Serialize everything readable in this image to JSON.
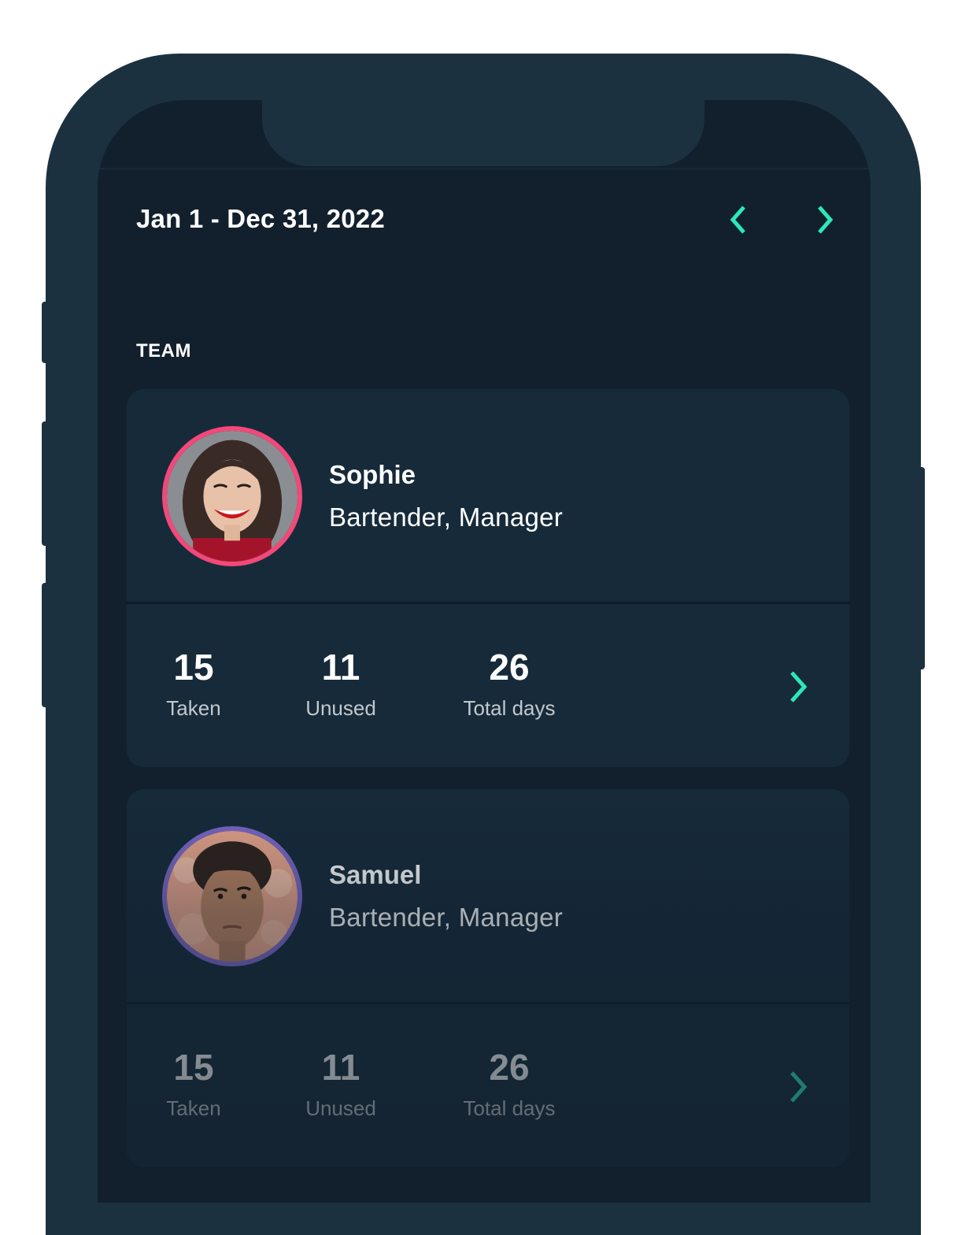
{
  "header": {
    "date_range": "Jan 1 - Dec 31, 2022",
    "prev_icon": "chevron-left-icon",
    "next_icon": "chevron-right-icon"
  },
  "section_title": "TEAM",
  "colors": {
    "accent": "#2de8b8",
    "screen_bg": "#12202d",
    "card_bg": "#162a3a",
    "frame": "#1c3140"
  },
  "team": [
    {
      "name": "Sophie",
      "role": "Bartender, Manager",
      "ring_color": "#f2487a",
      "stats": [
        {
          "value": "15",
          "label": "Taken"
        },
        {
          "value": "11",
          "label": "Unused"
        },
        {
          "value": "26",
          "label": "Total days"
        }
      ],
      "open_icon": "chevron-right-icon"
    },
    {
      "name": "Samuel",
      "role": "Bartender, Manager",
      "ring_color": "#7b68c9",
      "stats": [
        {
          "value": "15",
          "label": "Taken"
        },
        {
          "value": "11",
          "label": "Unused"
        },
        {
          "value": "26",
          "label": "Total days"
        }
      ],
      "open_icon": "chevron-right-icon"
    }
  ]
}
